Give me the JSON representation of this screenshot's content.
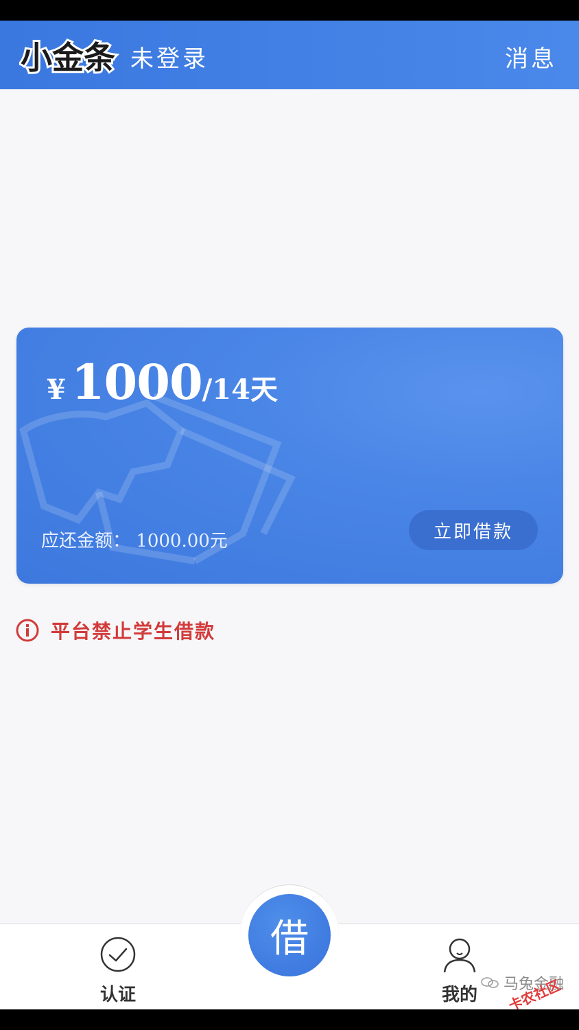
{
  "header": {
    "logo_text": "小金条",
    "login_status": "未登录",
    "messages_label": "消息"
  },
  "loan_card": {
    "currency_symbol": "¥",
    "amount": "1000",
    "term": "/14天",
    "due_label": "应还金额：",
    "due_amount": "1000.00元",
    "borrow_button": "立即借款"
  },
  "notice": {
    "text": "平台禁止学生借款",
    "color": "#d23b3b"
  },
  "tabbar": {
    "auth_label": "认证",
    "borrow_label": "借",
    "mine_label": "我的"
  },
  "watermark": {
    "account": "马兔金融",
    "badge": "卡农社区"
  },
  "colors": {
    "primary": "#3a78e0",
    "card": "#4a86e6",
    "button_dark": "#3a6fcf"
  }
}
